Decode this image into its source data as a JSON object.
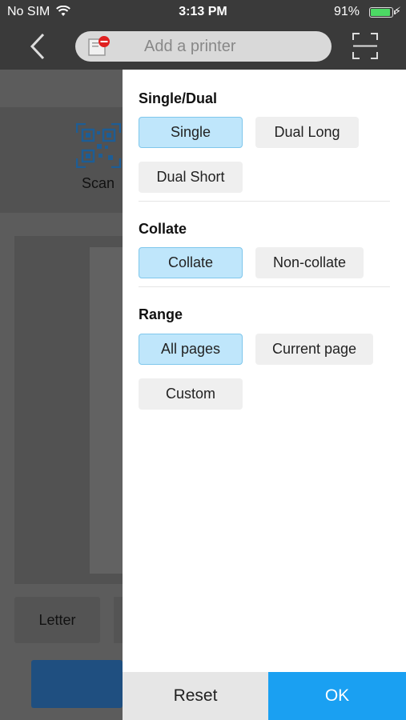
{
  "status_bar": {
    "carrier": "No SIM",
    "time": "3:13 PM",
    "battery": "91%",
    "battery_level": 0.91
  },
  "nav": {
    "search_placeholder": "Add a printer"
  },
  "background": {
    "scan_label": "Scan",
    "paper_size": "Letter"
  },
  "panel": {
    "sections": [
      {
        "title": "Single/Dual",
        "options": [
          "Single",
          "Dual Long",
          "Dual Short"
        ],
        "selected": "Single"
      },
      {
        "title": "Collate",
        "options": [
          "Collate",
          "Non-collate"
        ],
        "selected": "Collate"
      },
      {
        "title": "Range",
        "options": [
          "All pages",
          "Current page",
          "Custom"
        ],
        "selected": "All pages"
      }
    ],
    "reset_label": "Reset",
    "ok_label": "OK"
  },
  "colors": {
    "selected_fill": "#bfe6fb",
    "ok_blue": "#1aa0f2",
    "battery_green": "#4cd964"
  }
}
